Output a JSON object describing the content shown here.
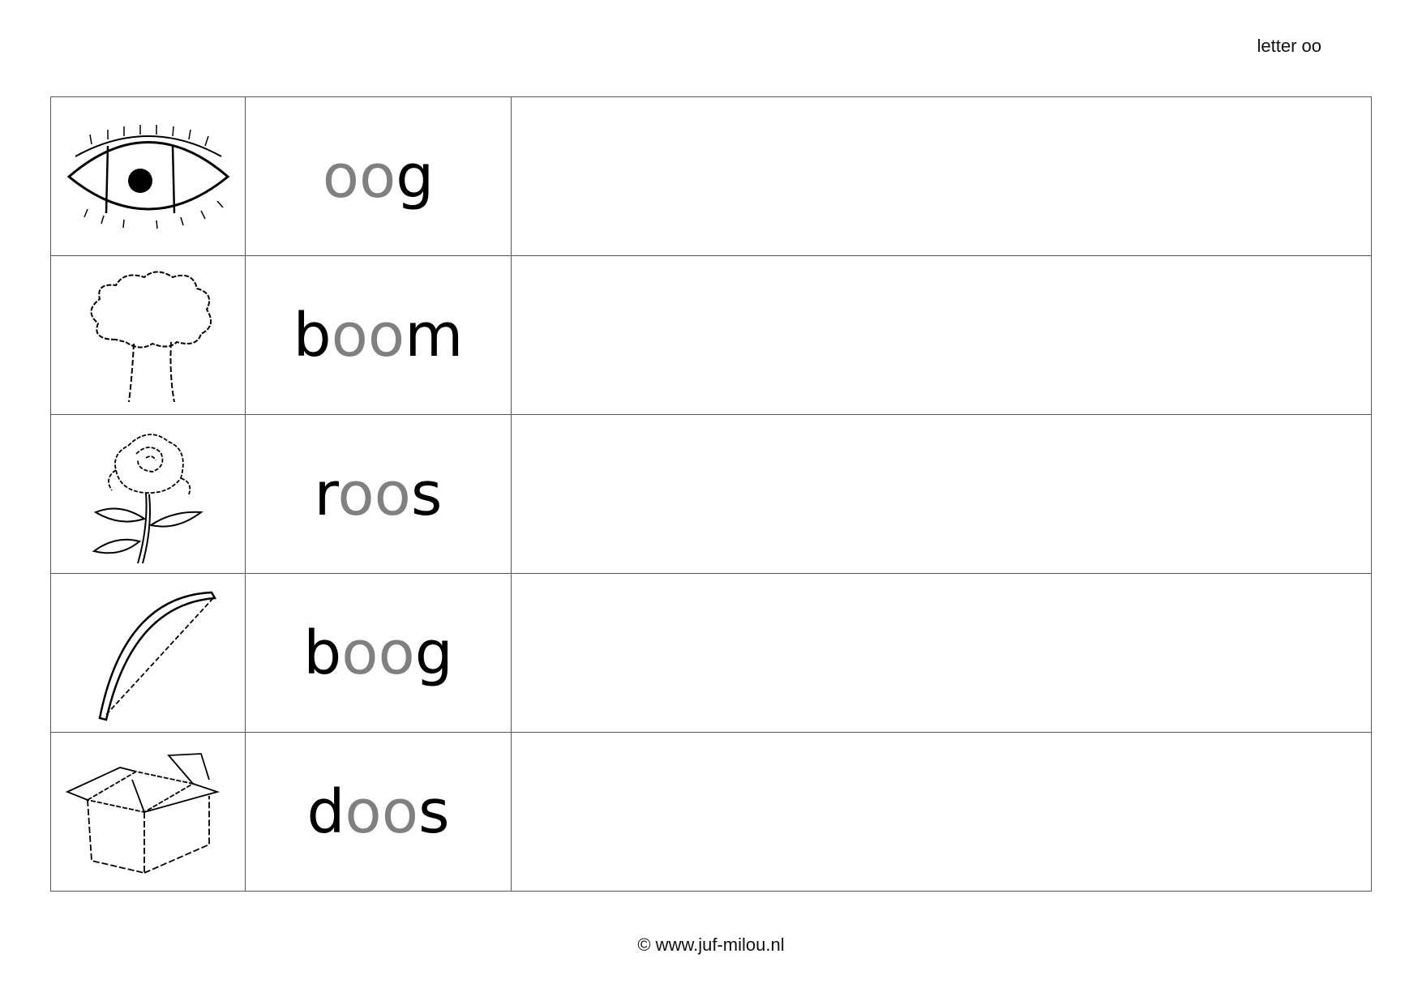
{
  "header": {
    "label": "letter oo"
  },
  "rows": [
    {
      "icon": "eye-icon",
      "pre": "",
      "hl": "oo",
      "post": "g"
    },
    {
      "icon": "tree-icon",
      "pre": "b",
      "hl": "oo",
      "post": "m"
    },
    {
      "icon": "rose-icon",
      "pre": "r",
      "hl": "oo",
      "post": "s"
    },
    {
      "icon": "bow-icon",
      "pre": "b",
      "hl": "oo",
      "post": "g"
    },
    {
      "icon": "box-icon",
      "pre": "d",
      "hl": "oo",
      "post": "s"
    }
  ],
  "footer": {
    "copyright": "© www.juf-milou.nl"
  },
  "colors": {
    "highlight": "#808080",
    "text": "#000000",
    "grid": "#555555"
  }
}
